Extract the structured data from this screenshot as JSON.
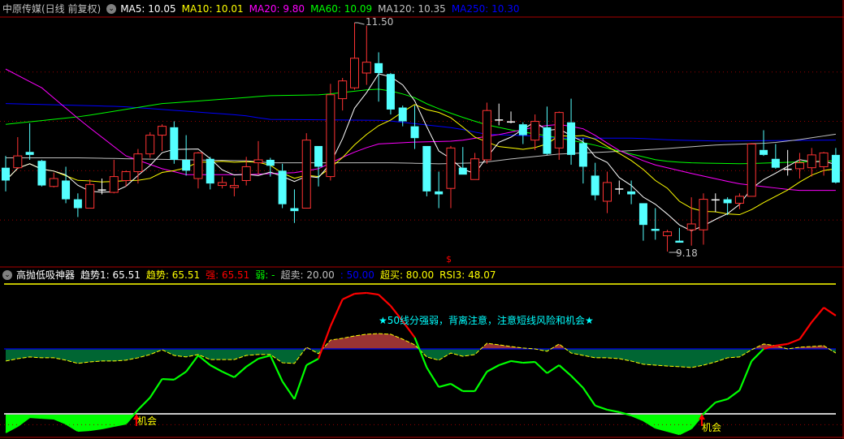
{
  "header": {
    "title": "中原传媒(日线 前复权)",
    "ma5": "MA5: 10.05",
    "ma10": "MA10: 10.01",
    "ma20": "MA20: 9.80",
    "ma60": "MA60: 10.09",
    "ma120": "MA120: 10.35",
    "ma250": "MA250: 10.30"
  },
  "indicator_header": {
    "name": "高抛低吸神器",
    "trend1": "趋势1: 65.51",
    "trend": "趋势: 65.51",
    "strong": "强: 65.51",
    "weak": "弱: -",
    "oversold": "超卖: 20.00",
    "mid": ": 50.00",
    "overbought": "超买: 80.00",
    "rsi3": "RSI3: 48.07"
  },
  "annotations": {
    "high_label": "11.50",
    "low_label": "9.18",
    "note": "★50线分强弱，背离注意，注意短线风险和机会★",
    "signal1": "机会",
    "signal2": "机会",
    "cursor_marker": "$"
  },
  "colors": {
    "up": "#ff3333",
    "down": "#54ffff",
    "ma5": "#ffffff",
    "ma10": "#ffff00",
    "ma20": "#ff00ff",
    "ma60": "#00ff00",
    "ma120": "#c0c0c0",
    "ma250": "#0000ff",
    "strong": "#ff0000",
    "weak": "#00ff00",
    "fill_above": "#993333",
    "fill_below": "#006633",
    "oversold_fill": "#00ff00"
  },
  "chart_data": [
    {
      "type": "candlestick",
      "title": "中原传媒(日线 前复权)",
      "ylim": [
        9.1,
        11.6
      ],
      "grid_prices": [
        11.0,
        10.5,
        10.0,
        9.5
      ],
      "candles_ohlc": [
        [
          10.03,
          10.15,
          9.79,
          9.9
        ],
        [
          10.03,
          10.34,
          10.02,
          10.15
        ],
        [
          10.19,
          10.48,
          10.11,
          10.16
        ],
        [
          10.1,
          10.11,
          9.84,
          9.85
        ],
        [
          9.84,
          9.98,
          9.83,
          9.92
        ],
        [
          9.9,
          10.04,
          9.67,
          9.71
        ],
        [
          9.71,
          9.77,
          9.53,
          9.62
        ],
        [
          9.62,
          9.91,
          9.62,
          9.86
        ],
        [
          9.81,
          9.92,
          9.76,
          9.8
        ],
        [
          9.78,
          10.11,
          9.77,
          9.94
        ],
        [
          9.9,
          10.0,
          9.84,
          9.99
        ],
        [
          9.99,
          10.22,
          9.87,
          10.17
        ],
        [
          10.17,
          10.39,
          10.13,
          10.36
        ],
        [
          10.36,
          10.47,
          10.2,
          10.45
        ],
        [
          10.44,
          10.5,
          10.07,
          10.11
        ],
        [
          10.11,
          10.36,
          9.95,
          10.0
        ],
        [
          9.92,
          10.19,
          9.82,
          10.18
        ],
        [
          10.12,
          10.14,
          9.81,
          9.87
        ],
        [
          9.85,
          9.94,
          9.82,
          9.88
        ],
        [
          9.83,
          9.93,
          9.74,
          9.85
        ],
        [
          9.9,
          10.14,
          9.85,
          10.04
        ],
        [
          10.08,
          10.3,
          9.96,
          10.11
        ],
        [
          10.11,
          10.13,
          9.94,
          10.05
        ],
        [
          10.0,
          10.07,
          9.62,
          9.66
        ],
        [
          9.62,
          9.81,
          9.47,
          9.59
        ],
        [
          9.62,
          10.38,
          9.62,
          10.31
        ],
        [
          10.25,
          10.25,
          9.84,
          10.04
        ],
        [
          9.94,
          10.88,
          9.9,
          10.77
        ],
        [
          10.73,
          10.94,
          10.61,
          10.91
        ],
        [
          10.84,
          11.5,
          10.82,
          11.14
        ],
        [
          10.99,
          11.47,
          10.87,
          11.1
        ],
        [
          11.09,
          11.2,
          10.7,
          10.99
        ],
        [
          10.98,
          10.99,
          10.57,
          10.62
        ],
        [
          10.64,
          10.66,
          10.45,
          10.5
        ],
        [
          10.45,
          10.66,
          10.22,
          10.33
        ],
        [
          10.25,
          10.25,
          9.74,
          9.79
        ],
        [
          9.79,
          9.99,
          9.62,
          9.76
        ],
        [
          9.82,
          10.25,
          9.62,
          10.23
        ],
        [
          10.03,
          10.24,
          9.96,
          9.96
        ],
        [
          9.91,
          10.18,
          9.91,
          10.12
        ],
        [
          10.11,
          10.69,
          10.07,
          10.61
        ],
        [
          10.52,
          10.68,
          10.46,
          10.52
        ],
        [
          10.5,
          10.6,
          10.48,
          10.49
        ],
        [
          10.47,
          10.49,
          10.27,
          10.36
        ],
        [
          10.31,
          10.57,
          10.21,
          10.5
        ],
        [
          10.44,
          10.65,
          10.16,
          10.17
        ],
        [
          10.23,
          10.6,
          10.11,
          10.59
        ],
        [
          10.49,
          10.73,
          10.06,
          10.16
        ],
        [
          10.28,
          10.33,
          9.87,
          10.04
        ],
        [
          9.95,
          10.08,
          9.7,
          9.75
        ],
        [
          9.69,
          9.99,
          9.57,
          9.88
        ],
        [
          9.82,
          9.9,
          9.76,
          9.82
        ],
        [
          9.79,
          9.9,
          9.66,
          9.76
        ],
        [
          9.67,
          9.67,
          9.29,
          9.45
        ],
        [
          9.41,
          9.62,
          9.3,
          9.39
        ],
        [
          9.34,
          9.4,
          9.18,
          9.38
        ],
        [
          9.29,
          9.42,
          9.27,
          9.27
        ],
        [
          9.4,
          9.73,
          9.24,
          9.46
        ],
        [
          9.4,
          9.77,
          9.25,
          9.71
        ],
        [
          9.7,
          9.77,
          9.58,
          9.71
        ],
        [
          9.71,
          9.73,
          9.55,
          9.67
        ],
        [
          9.67,
          9.77,
          9.61,
          9.74
        ],
        [
          9.74,
          10.28,
          9.74,
          10.27
        ],
        [
          10.21,
          10.41,
          10.15,
          10.16
        ],
        [
          10.12,
          10.27,
          10.02,
          10.03
        ],
        [
          10.02,
          10.21,
          9.95,
          10.02
        ],
        [
          10.02,
          10.18,
          9.92,
          10.08
        ],
        [
          10.03,
          10.23,
          9.94,
          10.16
        ],
        [
          10.04,
          10.19,
          9.95,
          10.18
        ],
        [
          10.16,
          10.23,
          9.87,
          9.88
        ]
      ],
      "ma20_points": [
        [
          0,
          11.03
        ],
        [
          3,
          10.84
        ],
        [
          6.3,
          10.5
        ],
        [
          10,
          10.15
        ],
        [
          13,
          10.02
        ],
        [
          15,
          9.96
        ],
        [
          20,
          9.96
        ],
        [
          24,
          9.98
        ],
        [
          26,
          10.02
        ],
        [
          28.6,
          10.17
        ],
        [
          30.8,
          10.27
        ],
        [
          34,
          10.29
        ],
        [
          37.5,
          10.3
        ],
        [
          41.2,
          10.37
        ],
        [
          44.3,
          10.45
        ],
        [
          46.1,
          10.47
        ],
        [
          48.2,
          10.42
        ],
        [
          50.9,
          10.21
        ],
        [
          53.6,
          10.07
        ],
        [
          56.7,
          9.98
        ],
        [
          60.8,
          9.87
        ],
        [
          65.7,
          9.8
        ],
        [
          69,
          9.8
        ]
      ],
      "ma60_points": [
        [
          0,
          10.47
        ],
        [
          6.3,
          10.55
        ],
        [
          13,
          10.68
        ],
        [
          19.8,
          10.74
        ],
        [
          21.8,
          10.76
        ],
        [
          26.3,
          10.77
        ],
        [
          28.6,
          10.8
        ],
        [
          30.8,
          10.83
        ],
        [
          32.4,
          10.8
        ],
        [
          34,
          10.74
        ],
        [
          35.3,
          10.66
        ],
        [
          37.5,
          10.56
        ],
        [
          39.8,
          10.47
        ],
        [
          42.1,
          10.41
        ],
        [
          45.2,
          10.35
        ],
        [
          48.6,
          10.27
        ],
        [
          51.3,
          10.19
        ],
        [
          54.4,
          10.1
        ],
        [
          56.7,
          10.08
        ],
        [
          61.2,
          10.07
        ],
        [
          69,
          10.1
        ]
      ],
      "ma120_points": [
        [
          0,
          10.13
        ],
        [
          6,
          10.13
        ],
        [
          20,
          10.1
        ],
        [
          22,
          10.08
        ],
        [
          32,
          10.08
        ],
        [
          36,
          10.07
        ],
        [
          39.4,
          10.08
        ],
        [
          42.1,
          10.12
        ],
        [
          46.1,
          10.17
        ],
        [
          50,
          10.19
        ],
        [
          54.4,
          10.22
        ],
        [
          59,
          10.26
        ],
        [
          63.5,
          10.28
        ],
        [
          65.7,
          10.31
        ],
        [
          69,
          10.37
        ]
      ],
      "ma250_points": [
        [
          0,
          10.68
        ],
        [
          9.7,
          10.65
        ],
        [
          19.8,
          10.56
        ],
        [
          21.8,
          10.52
        ],
        [
          31.5,
          10.51
        ],
        [
          34.5,
          10.47
        ],
        [
          37.5,
          10.43
        ],
        [
          39.8,
          10.37
        ],
        [
          44.3,
          10.35
        ],
        [
          45.4,
          10.33
        ],
        [
          52.2,
          10.33
        ],
        [
          55.6,
          10.31
        ],
        [
          59.4,
          10.3
        ],
        [
          69,
          10.31
        ]
      ],
      "high_point": {
        "bar": 29,
        "price": 11.5
      },
      "low_point": {
        "bar": 55,
        "price": 9.18
      }
    },
    {
      "type": "line",
      "title": "高抛低吸神器",
      "ylim": [
        0,
        100
      ],
      "levels": {
        "overbought": 80,
        "mid": 50,
        "oversold": 20,
        "dotted": 15
      },
      "main": [
        11.4,
        14.4,
        18.5,
        18.1,
        17.8,
        15.5,
        12.1,
        12.5,
        13.3,
        14.4,
        15.5,
        21.9,
        27.5,
        36.1,
        35.8,
        39.5,
        47.0,
        42.5,
        39.5,
        36.9,
        41.8,
        45.5,
        47.0,
        35.0,
        26.8,
        42.5,
        45.5,
        60.5,
        72.9,
        75.5,
        75.9,
        75.1,
        69.9,
        62.8,
        55.3,
        41.4,
        32.4,
        33.9,
        30.5,
        30.5,
        39.5,
        42.5,
        44.4,
        43.6,
        44.0,
        38.8,
        42.5,
        37.6,
        32.0,
        23.8,
        21.9,
        20.8,
        19.3,
        17.0,
        13.6,
        12.1,
        10.6,
        13.3,
        20.0,
        25.3,
        26.8,
        30.9,
        44.4,
        50.0,
        51.5,
        52.3,
        54.5,
        62.4,
        69.1,
        65.4
      ],
      "trend": [
        44.4,
        45.5,
        46.3,
        45.9,
        45.9,
        44.8,
        43.3,
        44.0,
        44.4,
        44.4,
        44.8,
        45.9,
        47.4,
        49.6,
        47.0,
        46.3,
        47.4,
        45.1,
        45.1,
        45.1,
        47.0,
        47.4,
        47.4,
        43.6,
        43.3,
        50.8,
        47.8,
        54.1,
        54.9,
        56.0,
        56.8,
        57.1,
        56.8,
        54.5,
        51.9,
        46.3,
        44.8,
        48.1,
        46.6,
        47.4,
        52.6,
        51.9,
        51.1,
        50.4,
        50.0,
        48.9,
        52.3,
        48.1,
        47.0,
        45.9,
        45.9,
        45.5,
        44.4,
        42.9,
        42.5,
        42.1,
        41.8,
        41.4,
        42.5,
        44.0,
        45.9,
        46.3,
        49.6,
        52.3,
        51.5,
        50.0,
        50.8,
        51.1,
        51.5,
        48.1
      ],
      "signals": [
        {
          "bar": 11,
          "label": "机会"
        },
        {
          "bar": 58,
          "label": "机会"
        }
      ]
    }
  ]
}
